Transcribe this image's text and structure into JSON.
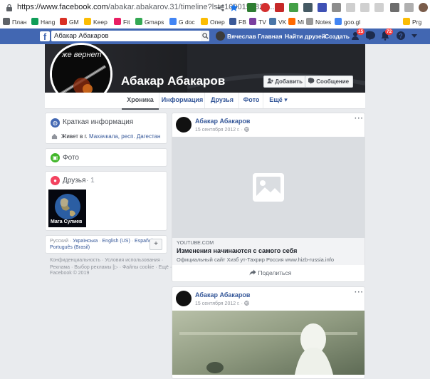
{
  "browser": {
    "url_host": "https://www.facebook.com",
    "url_rest": "/abakar.abakarov.31/timeline?lst=1000150825...",
    "bookmarks": [
      {
        "label": "План",
        "color": "#5f6368"
      },
      {
        "label": "Hang",
        "color": "#0f9d58"
      },
      {
        "label": "GM",
        "color": "#d93025"
      },
      {
        "label": "Keep",
        "color": "#fbbc04"
      },
      {
        "label": "Fit",
        "color": "#e91e63"
      },
      {
        "label": "Gmaps",
        "color": "#34a853"
      },
      {
        "label": "G doc",
        "color": "#4285f4"
      },
      {
        "label": "Опер",
        "color": "#fbbc04"
      },
      {
        "label": "FB",
        "color": "#3b5998"
      },
      {
        "label": "TV",
        "color": "#7b3fa0"
      },
      {
        "label": "VK",
        "color": "#4a76a8"
      },
      {
        "label": "Mi",
        "color": "#ff6900"
      },
      {
        "label": "Notes",
        "color": "#999999"
      },
      {
        "label": "goo.gl",
        "color": "#4285f4"
      },
      {
        "label": "Prg",
        "color": "#fbbc04"
      }
    ]
  },
  "fb_header": {
    "search_value": "Абакар Абакаров",
    "user_name": "Вячеслав",
    "nav_home": "Главная",
    "nav_find_friends": "Найти друзей",
    "nav_create": "Создать",
    "friend_requests_badge": "15",
    "notifications_badge": "72",
    "brand_color": "#4267b2"
  },
  "profile": {
    "name": "Абакар Абакаров",
    "picture_text": "же вернет",
    "add_friend_label": "Добавить",
    "message_label": "Сообщение",
    "tabs": [
      {
        "label": "Хроника"
      },
      {
        "label": "Информация"
      },
      {
        "label": "Друзья"
      },
      {
        "label": "Фото"
      },
      {
        "label": "Ещё ▾"
      }
    ]
  },
  "intro": {
    "title": "Краткая информация",
    "lives_prefix": "Живет в г.",
    "lives_city": "Махачкала, респ. Дагестан"
  },
  "photos": {
    "title": "Фото"
  },
  "friends": {
    "title": "Друзья",
    "count": "· 1",
    "friend_name": "Мага Сулиев"
  },
  "languages": {
    "line1": [
      "Русский",
      "Українська",
      "English (US)",
      "Español"
    ],
    "line2": [
      "Português (Brasil)"
    ],
    "add_label": "+"
  },
  "footer": {
    "line1": "Конфиденциальность · Условия использования ·",
    "line2": "Реклама · Выбор рекламы [▷ · Файлы cookie · Ещё ·",
    "line3": "Facebook © 2019"
  },
  "posts": [
    {
      "author": "Абакар Абакаров",
      "date": "15 сентября 2012 г. ·",
      "link_domain": "YOUTUBE.COM",
      "link_title": "Изменения начинаются с самого себя",
      "link_desc": "Официальный сайт Хизб ут-Тахрир Россия www.hizb-russia.info",
      "share_label": "Поделиться"
    },
    {
      "author": "Абакар Абакаров",
      "date": "15 сентября 2012 г. ·"
    }
  ]
}
